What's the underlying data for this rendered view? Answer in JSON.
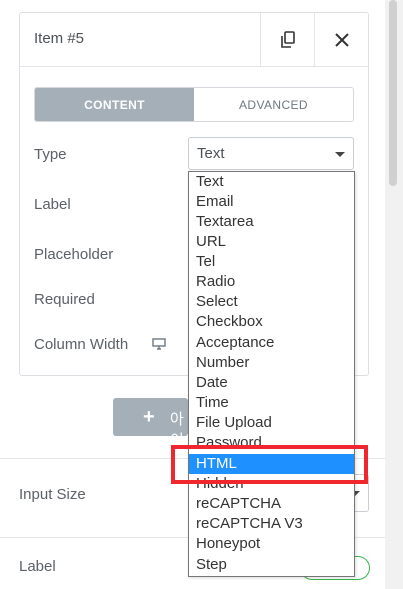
{
  "item": {
    "title": "Item #5",
    "copy_icon": "copy-icon",
    "close_icon": "close-icon"
  },
  "tabs": [
    {
      "label": "CONTENT",
      "active": true
    },
    {
      "label": "ADVANCED",
      "active": false
    }
  ],
  "fields": {
    "type_label": "Type",
    "type_value": "Text",
    "label_label": "Label",
    "placeholder_label": "Placeholder",
    "required_label": "Required",
    "column_width_label": "Column Width"
  },
  "add_button": {
    "label": "아이"
  },
  "section": {
    "input_size_label": "Input Size",
    "label_label": "Label"
  },
  "dropdown_options": [
    "Text",
    "Email",
    "Textarea",
    "URL",
    "Tel",
    "Radio",
    "Select",
    "Checkbox",
    "Acceptance",
    "Number",
    "Date",
    "Time",
    "File Upload",
    "Password",
    "HTML",
    "Hidden",
    "reCAPTCHA",
    "reCAPTCHA V3",
    "Honeypot",
    "Step"
  ],
  "dropdown_selected": "HTML",
  "colors": {
    "accent": "#a4afb7",
    "selection": "#1e90ff",
    "highlight": "#f0272e",
    "toggle": "#39b54a"
  }
}
